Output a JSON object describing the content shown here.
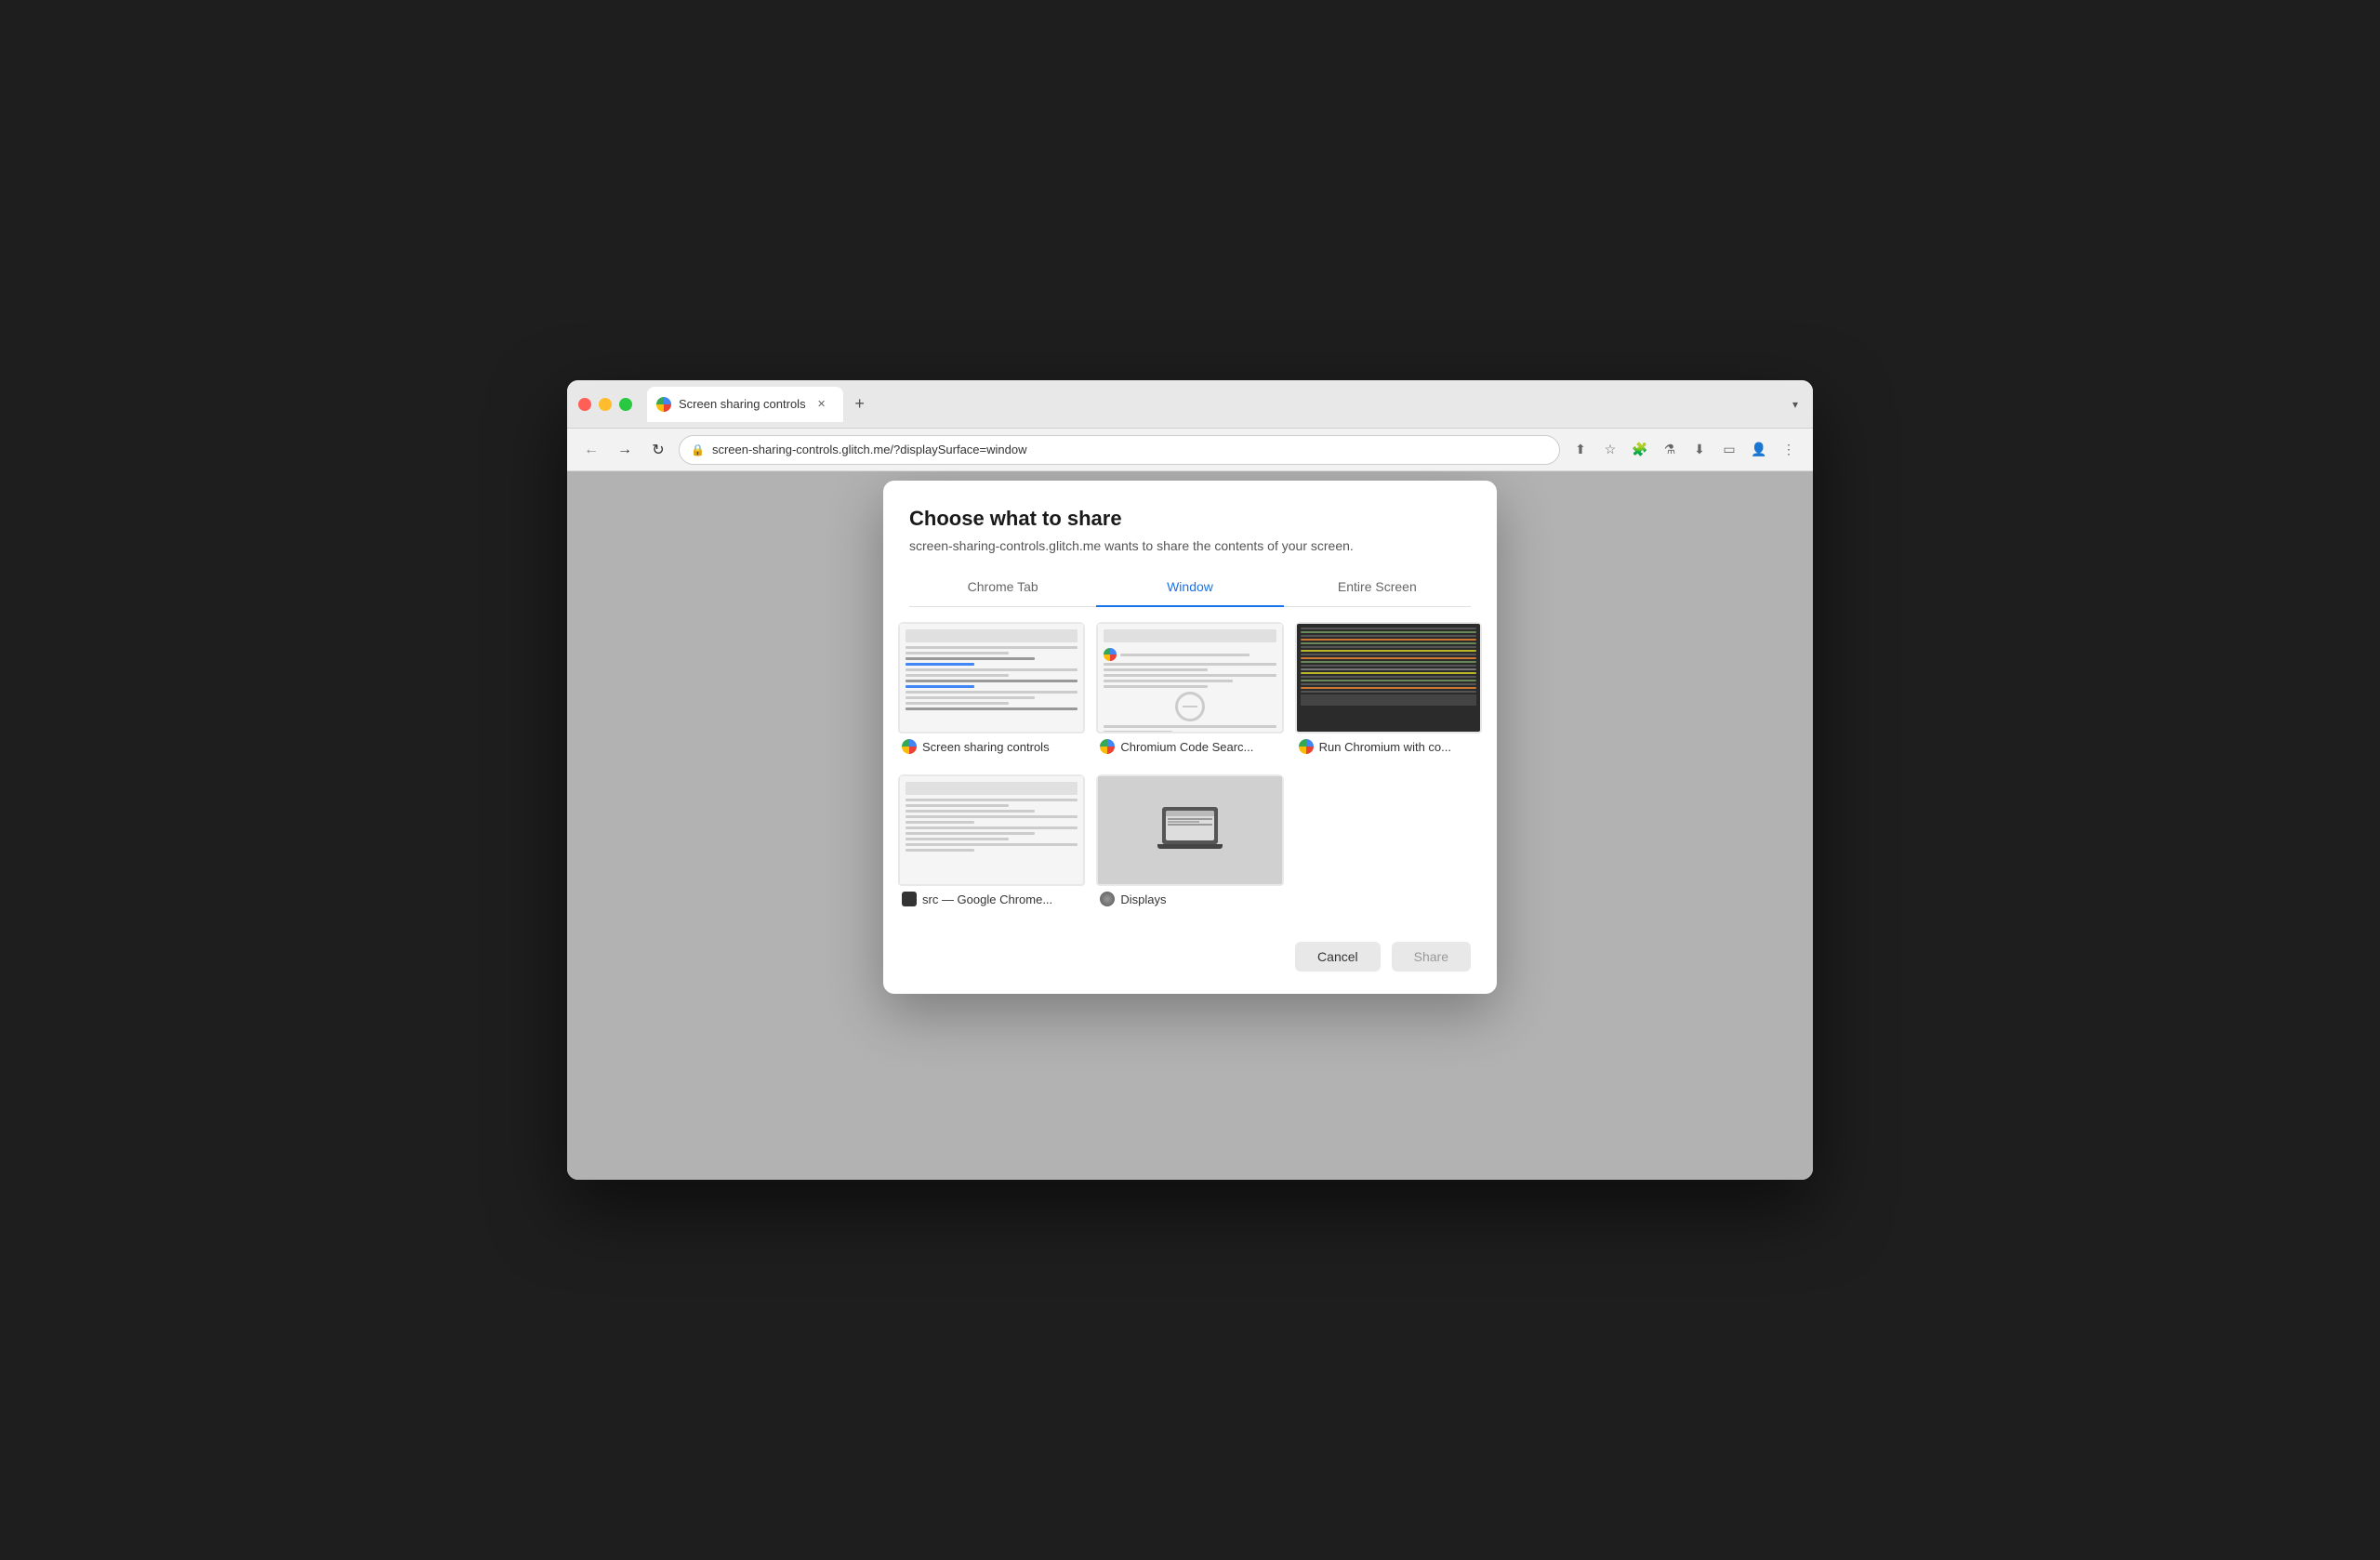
{
  "browser": {
    "tab": {
      "title": "Screen sharing controls",
      "favicon": "chrome-icon"
    },
    "new_tab_label": "+",
    "chevron": "▾",
    "nav": {
      "back": "←",
      "forward": "→",
      "refresh": "↻",
      "url": "screen-sharing-controls.glitch.me/?displaySurface=window",
      "lock_icon": "🔒"
    }
  },
  "modal": {
    "title": "Choose what to share",
    "subtitle": "screen-sharing-controls.glitch.me wants to share the contents of your screen.",
    "tabs": [
      {
        "id": "chrome-tab",
        "label": "Chrome Tab",
        "active": false
      },
      {
        "id": "window",
        "label": "Window",
        "active": true
      },
      {
        "id": "entire-screen",
        "label": "Entire Screen",
        "active": false
      }
    ],
    "windows": [
      {
        "id": "win1",
        "name": "Screen sharing controls",
        "icon_type": "chrome",
        "thumbnail_type": "webpage"
      },
      {
        "id": "win2",
        "name": "Chromium Code Searc...",
        "icon_type": "chrome",
        "thumbnail_type": "webpage2"
      },
      {
        "id": "win3",
        "name": "Run Chromium with co...",
        "icon_type": "chrome",
        "thumbnail_type": "code"
      },
      {
        "id": "win4",
        "name": "src — Google Chrome...",
        "icon_type": "dark",
        "thumbnail_type": "text"
      },
      {
        "id": "win5",
        "name": "Displays",
        "icon_type": "gray",
        "thumbnail_type": "laptop"
      }
    ],
    "cancel_label": "Cancel",
    "share_label": "Share"
  }
}
